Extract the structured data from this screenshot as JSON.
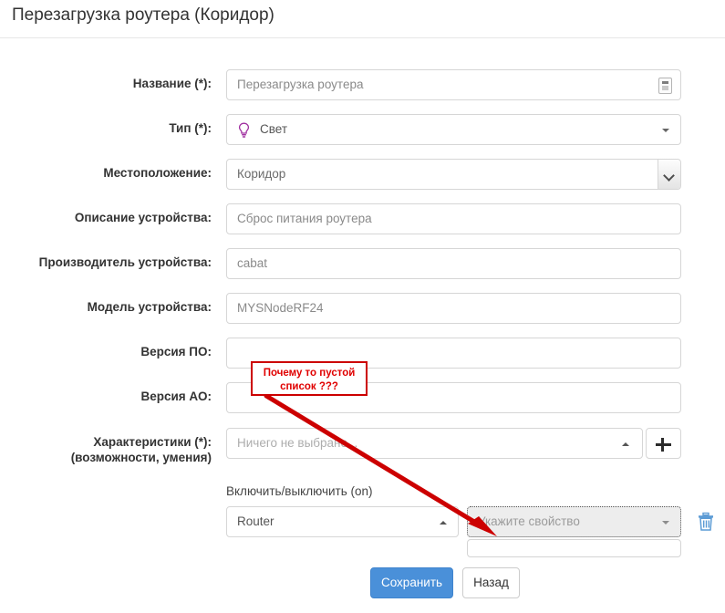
{
  "header": {
    "title": "Перезагрузка роутера (Коридор)"
  },
  "form": {
    "rows": [
      {
        "label": "Название (*):",
        "value": "Перезагрузка роутера",
        "control": "text-with-icon",
        "icon": "clipboard-icon"
      },
      {
        "label": "Тип (*):",
        "value": "Свет",
        "control": "dropdown",
        "icon": "lightbulb-icon",
        "icon_color": "#a030a0"
      },
      {
        "label": "Местоположение:",
        "value": "Коридор",
        "control": "native-select"
      },
      {
        "label": "Описание устройства:",
        "value": "Сброс питания роутера",
        "control": "text"
      },
      {
        "label": "Производитель устройства:",
        "value": "cabat",
        "control": "text"
      },
      {
        "label": "Модель устройства:",
        "value": "MYSNodeRF24",
        "control": "text"
      },
      {
        "label": "Версия ПО:",
        "value": "",
        "control": "text"
      },
      {
        "label": "Версия АО:",
        "value": "",
        "control": "text"
      }
    ],
    "characteristics": {
      "label_line1": "Характеристики (*):",
      "label_line2": "(возможности, умения)",
      "placeholder": "Ничего не выбрано...",
      "add_button": "+"
    },
    "capability": {
      "title": "Включить/выключить (on)",
      "device_value": "Router",
      "property_placeholder": "Укажите свойство",
      "delete_icon": "trash-icon",
      "delete_icon_color": "#5b9bd5"
    }
  },
  "buttons": {
    "save": "Сохранить",
    "back": "Назад",
    "save_color": "#4a90d9"
  },
  "annotation": {
    "line1": "Почему то пустой",
    "line2": "список ???",
    "color": "#cc0000"
  }
}
